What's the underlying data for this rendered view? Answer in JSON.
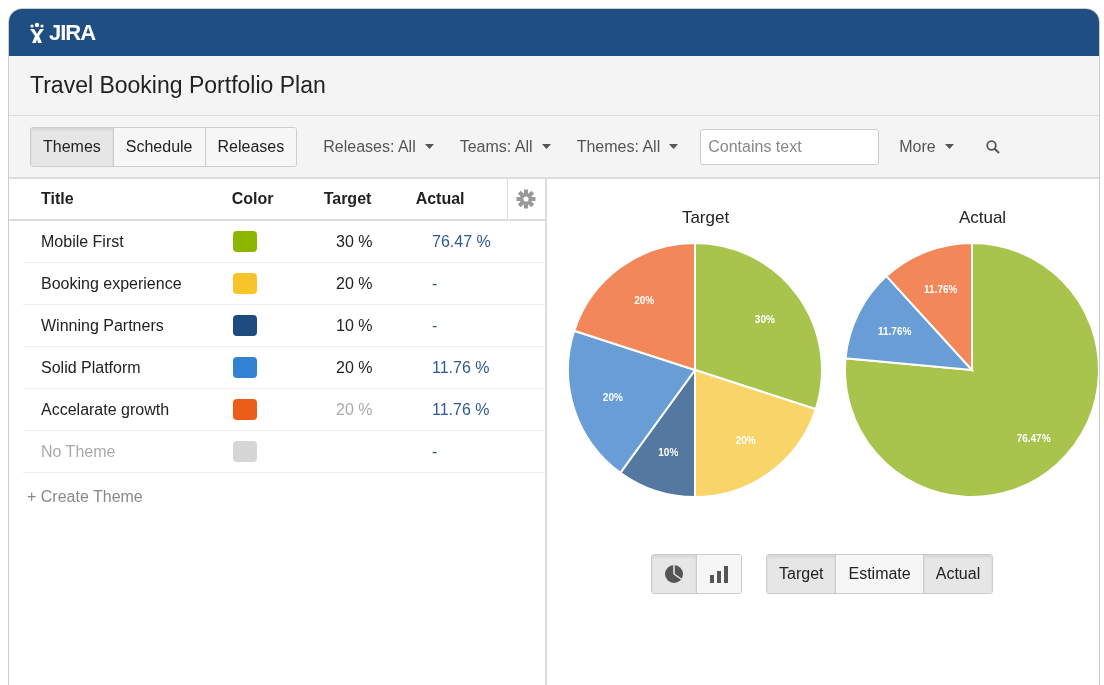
{
  "header": {
    "logo": "JIRA"
  },
  "page": {
    "title": "Travel Booking Portfolio Plan"
  },
  "view_tabs": [
    {
      "label": "Themes",
      "selected": true
    },
    {
      "label": "Schedule",
      "selected": false
    },
    {
      "label": "Releases",
      "selected": false
    }
  ],
  "filters": [
    {
      "label": "Releases: All"
    },
    {
      "label": "Teams: All"
    },
    {
      "label": "Themes: All"
    }
  ],
  "search": {
    "placeholder": "Contains text"
  },
  "more": {
    "label": "More"
  },
  "table": {
    "columns": [
      "Title",
      "Color",
      "Target",
      "Actual"
    ],
    "rows": [
      {
        "title": "Mobile First",
        "color": "#8db600",
        "target": "30 %",
        "target_dimmed": false,
        "actual": "76.47 %",
        "dimmed": false
      },
      {
        "title": "Booking experience",
        "color": "#f8c42a",
        "target": "20 %",
        "target_dimmed": false,
        "actual": "-",
        "dimmed": false
      },
      {
        "title": "Winning Partners",
        "color": "#1d4b80",
        "target": "10 %",
        "target_dimmed": false,
        "actual": "-",
        "dimmed": false
      },
      {
        "title": "Solid Platform",
        "color": "#3281d3",
        "target": "20 %",
        "target_dimmed": false,
        "actual": "11.76 %",
        "dimmed": false
      },
      {
        "title": "Accelarate growth",
        "color": "#ec5d1a",
        "target": "20 %",
        "target_dimmed": true,
        "actual": "11.76 %",
        "dimmed": false
      },
      {
        "title": "No Theme",
        "color": "#d6d6d6",
        "target": "",
        "target_dimmed": false,
        "actual": "-",
        "dimmed": true
      }
    ],
    "create": "+ Create Theme"
  },
  "charts": [
    {
      "chart_data": {
        "type": "pie",
        "title": "Target",
        "values": [
          30,
          20,
          10,
          20,
          20
        ],
        "colors": [
          "#a8c44c",
          "#f9d468",
          "#54789f",
          "#689dd6",
          "#f2875a"
        ],
        "value_labels": [
          "30%",
          "20%",
          "10%",
          "20%",
          "20%"
        ]
      }
    },
    {
      "chart_data": {
        "type": "pie",
        "title": "Actual",
        "values": [
          76.47,
          11.76,
          11.76
        ],
        "colors": [
          "#a8c44c",
          "#689dd6",
          "#f2875a"
        ],
        "value_labels": [
          "76.47%",
          "11.76%",
          "11.76%"
        ]
      }
    }
  ],
  "chart_types": [
    {
      "kind": "pie",
      "selected": true
    },
    {
      "kind": "bar",
      "selected": false
    }
  ],
  "chart_toggles": [
    {
      "label": "Target",
      "selected": true
    },
    {
      "label": "Estimate",
      "selected": false
    },
    {
      "label": "Actual",
      "selected": true
    }
  ]
}
